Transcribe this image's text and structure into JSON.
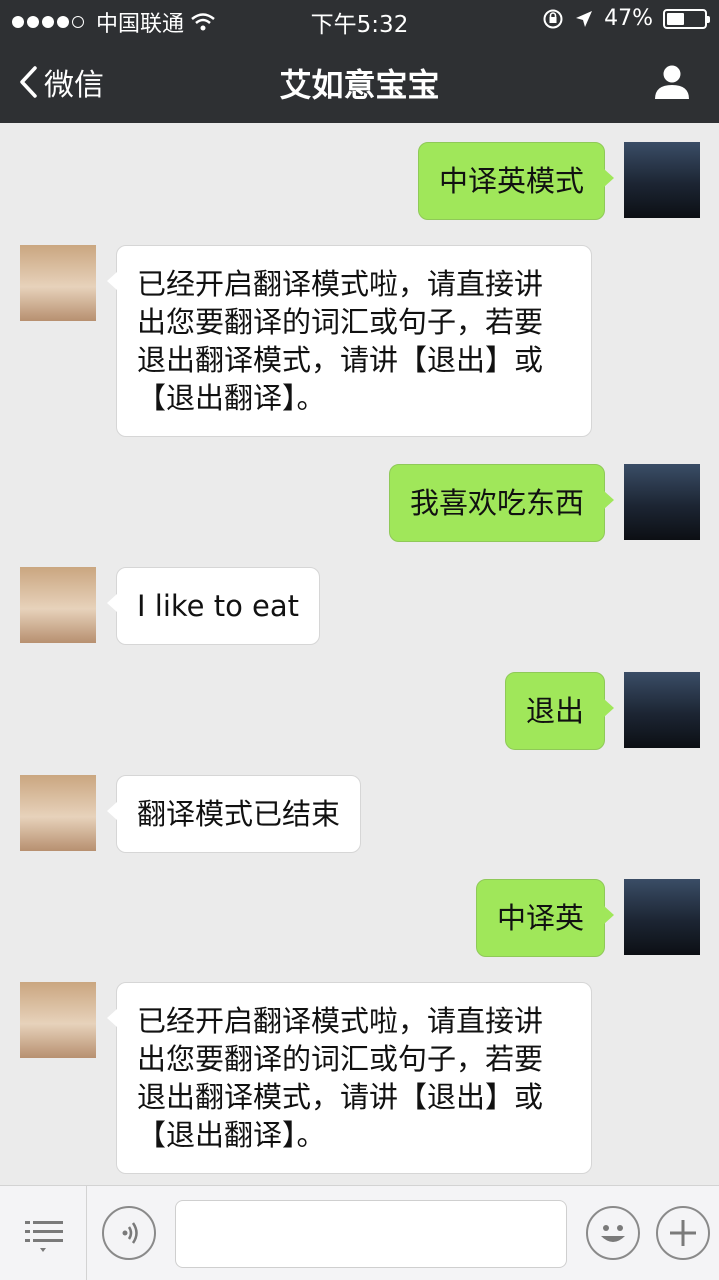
{
  "status_bar": {
    "carrier": "中国联通",
    "time": "下午5:32",
    "battery_percent": "47%",
    "battery_level": 0.47
  },
  "nav": {
    "back_label": "微信",
    "title": "艾如意宝宝"
  },
  "messages": [
    {
      "sender": "me",
      "text": "中译英模式"
    },
    {
      "sender": "bot",
      "text": "已经开启翻译模式啦，请直接讲出您要翻译的词汇或句子，若要退出翻译模式，请讲【退出】或【退出翻译】。"
    },
    {
      "sender": "me",
      "text": "我喜欢吃东西"
    },
    {
      "sender": "bot",
      "text": "I like to eat"
    },
    {
      "sender": "me",
      "text": "退出"
    },
    {
      "sender": "bot",
      "text": "翻译模式已结束"
    },
    {
      "sender": "me",
      "text": "中译英"
    },
    {
      "sender": "bot",
      "text": "已经开启翻译模式啦，请直接讲出您要翻译的词汇或句子，若要退出翻译模式，请讲【退出】或【退出翻译】。"
    }
  ],
  "input": {
    "value": ""
  },
  "colors": {
    "nav_bg": "#2e3033",
    "chat_bg": "#ebebeb",
    "my_bubble": "#a0e75a",
    "bot_bubble": "#ffffff"
  },
  "icons": {
    "back": "chevron-left-icon",
    "profile": "person-icon",
    "menu": "menu-icon",
    "voice": "voice-icon",
    "emoji": "smiley-icon",
    "plus": "plus-icon"
  }
}
